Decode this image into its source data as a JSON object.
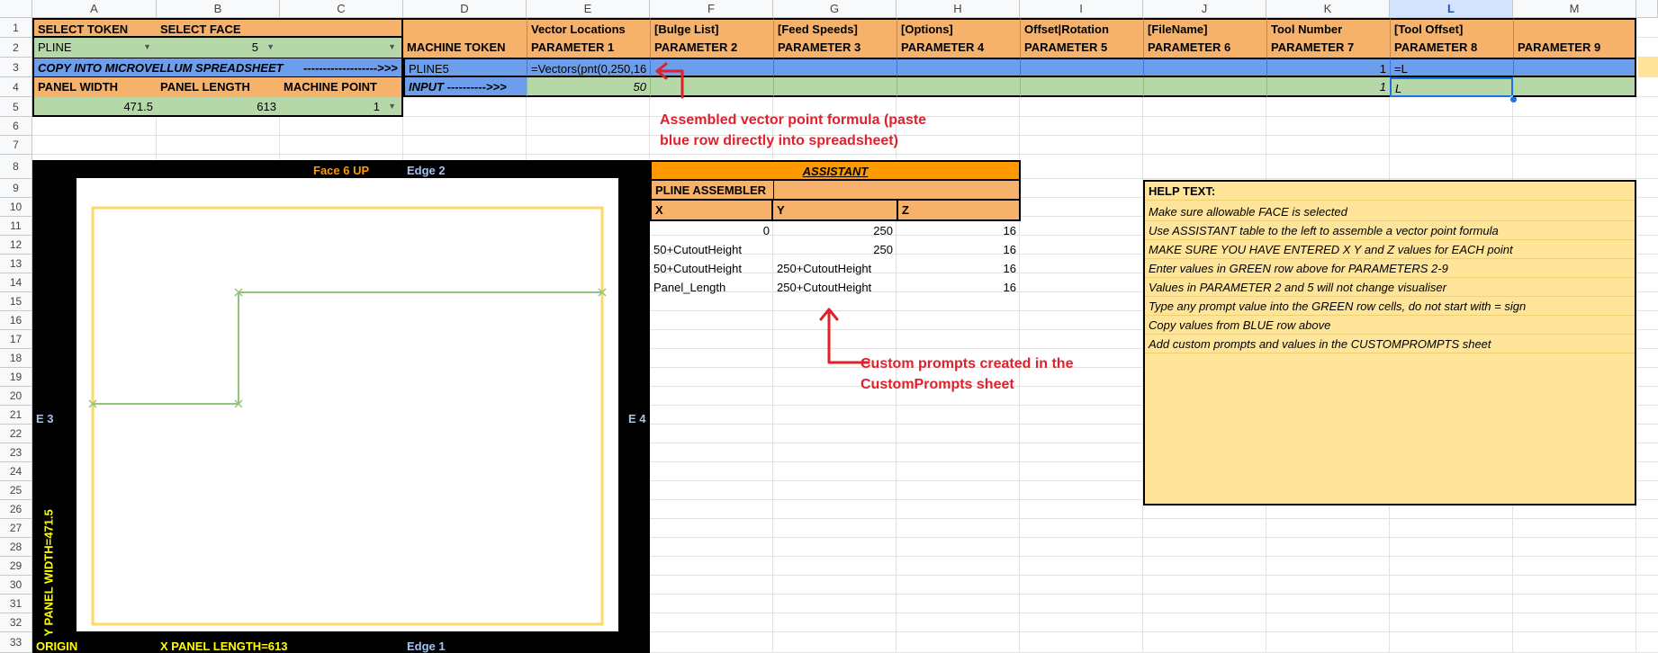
{
  "columns": [
    "A",
    "B",
    "C",
    "D",
    "E",
    "F",
    "G",
    "H",
    "I",
    "J",
    "K",
    "L",
    "M"
  ],
  "selected_column": "L",
  "rows": [
    "1",
    "2",
    "3",
    "4",
    "5",
    "6",
    "7",
    "8",
    "9",
    "10",
    "11",
    "12",
    "13",
    "14",
    "15",
    "16",
    "17",
    "18",
    "19",
    "20",
    "21",
    "22",
    "23",
    "24",
    "25",
    "26",
    "27",
    "28",
    "29",
    "30",
    "31",
    "32",
    "33"
  ],
  "top_left": {
    "select_token": "SELECT TOKEN",
    "select_face": "SELECT FACE",
    "token_value": "PLINE",
    "face_value": "5",
    "copy_label": "COPY INTO MICROVELLUM SPREADSHEET",
    "copy_arrow": "------------------->>>",
    "panel_width": "PANEL WIDTH",
    "panel_length": "PANEL LENGTH",
    "machine_point": "MACHINE POINT",
    "panel_width_value": "471.5",
    "panel_length_value": "613",
    "machine_point_value": "1"
  },
  "params": {
    "header_row": [
      "",
      "Vector Locations",
      "[Bulge List]",
      "[Feed Speeds]",
      "[Options]",
      "Offset|Rotation",
      "[FileName]",
      "Tool Number",
      "[Tool Offset]",
      ""
    ],
    "param_row": [
      "MACHINE TOKEN",
      "PARAMETER 1",
      "PARAMETER 2",
      "PARAMETER 3",
      "PARAMETER 4",
      "PARAMETER 5",
      "PARAMETER 6",
      "PARAMETER 7",
      "PARAMETER 8",
      "PARAMETER 9"
    ],
    "blue_row_token": "PLINE5",
    "blue_row_formula": "=Vectors(pnt(0,250,16",
    "blue_row_tool": "1",
    "blue_row_offset": "=L",
    "input_label": "INPUT ---------->>>",
    "input_value": "50",
    "input_tool": "1",
    "input_offset": "L"
  },
  "assistant": {
    "title": "ASSISTANT",
    "subtitle": "PLINE ASSEMBLER",
    "headers": [
      "X",
      "Y",
      "Z"
    ],
    "rows": [
      [
        "0",
        "250",
        "16"
      ],
      [
        "50+CutoutHeight",
        "250",
        "16"
      ],
      [
        "50+CutoutHeight",
        "250+CutoutHeight",
        "16"
      ],
      [
        "Panel_Length",
        "250+CutoutHeight",
        "16"
      ]
    ]
  },
  "help": {
    "title": "HELP TEXT:",
    "lines": [
      "Make sure allowable FACE is selected",
      "Use ASSISTANT table to the left to assemble a vector point formula",
      "MAKE SURE YOU HAVE ENTERED X Y and Z values for EACH point",
      "Enter values in GREEN row above for PARAMETERS 2-9",
      "Values in PARAMETER 2 and 5 will not change visualiser",
      "Type any prompt value into the GREEN row cells, do not start with = sign",
      "Copy values from BLUE row above",
      "Add custom prompts and values in the CUSTOMPROMPTS sheet"
    ]
  },
  "visualiser": {
    "face_label": "Face 6 UP",
    "edge_top": "Edge 2",
    "edge_left": "E 3",
    "edge_right": "E 4",
    "edge_bottom": "Edge 1",
    "y_label": "Y    PANEL WIDTH=471.5",
    "origin": "ORIGIN",
    "x_label": "X    PANEL LENGTH=613",
    "colors": {
      "face": "#ff9900",
      "edge": "#a4c2f4",
      "axis": "#ffff00",
      "panel": "#ffd966",
      "path": "#93c47d"
    }
  },
  "annotations": {
    "formula_note_1": "Assembled vector point formula (paste",
    "formula_note_2": "blue row directly into spreadsheet)",
    "prompts_note_1": "Custom prompts created in the",
    "prompts_note_2": "CustomPrompts sheet"
  }
}
